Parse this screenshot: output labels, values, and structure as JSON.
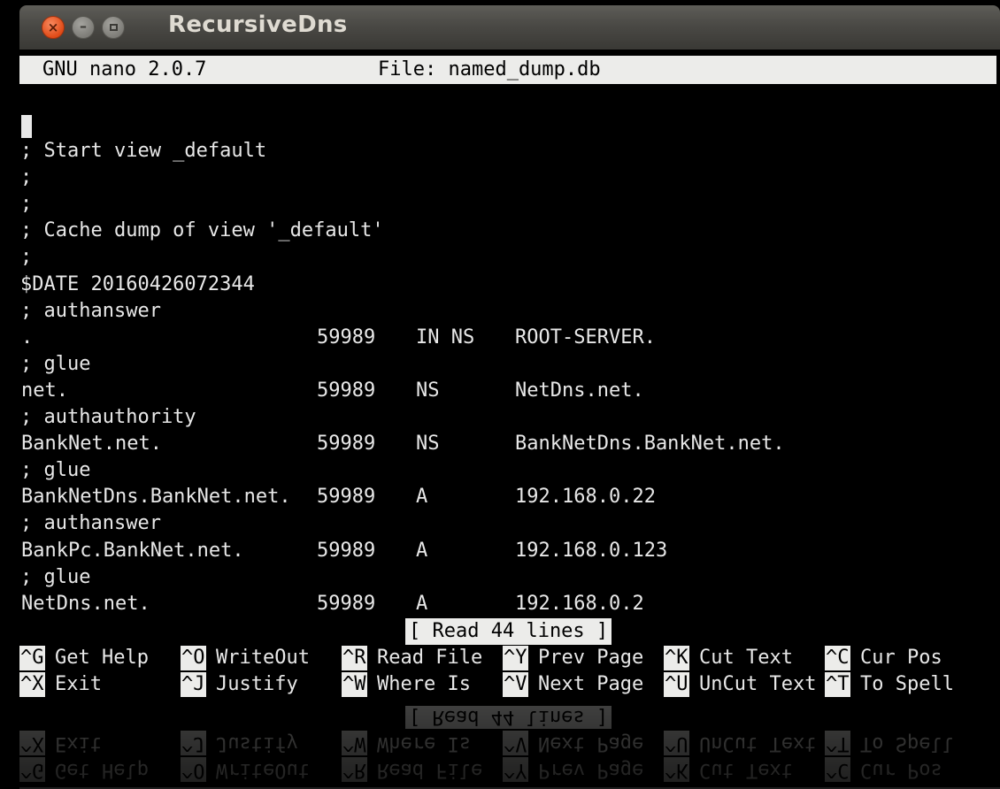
{
  "window": {
    "title": "RecursiveDns",
    "close_glyph": "×",
    "minimize_glyph": "–"
  },
  "nano": {
    "version": "GNU nano 2.0.7",
    "file": "File: named_dump.db",
    "status": "[ Read 44 lines ]"
  },
  "content": {
    "lines": [
      {
        "text": "; Start view _default"
      },
      {
        "text": ";"
      },
      {
        "text": ";"
      },
      {
        "text": "; Cache dump of view '_default'"
      },
      {
        "text": ";"
      },
      {
        "text": "$DATE 20160426072344"
      },
      {
        "text": "; authanswer"
      },
      {
        "name": ".",
        "ttl": "59989",
        "type": "IN NS",
        "data": "ROOT-SERVER."
      },
      {
        "text": "; glue"
      },
      {
        "name": "net.",
        "ttl": "59989",
        "type": "NS",
        "data": "NetDns.net."
      },
      {
        "text": "; authauthority"
      },
      {
        "name": "BankNet.net.",
        "ttl": "59989",
        "type": "NS",
        "data": "BankNetDns.BankNet.net."
      },
      {
        "text": "; glue"
      },
      {
        "name": "BankNetDns.BankNet.net.",
        "ttl": "59989",
        "type": "A",
        "data": "192.168.0.22"
      },
      {
        "text": "; authanswer"
      },
      {
        "name": "BankPc.BankNet.net.",
        "ttl": "59989",
        "type": "A",
        "data": "192.168.0.123"
      },
      {
        "text": "; glue"
      },
      {
        "name": "NetDns.net.",
        "ttl": "59989",
        "type": "A",
        "data": "192.168.0.2"
      }
    ]
  },
  "shortcuts": {
    "row1": [
      {
        "key": "^G",
        "label": "Get Help"
      },
      {
        "key": "^O",
        "label": "WriteOut"
      },
      {
        "key": "^R",
        "label": "Read File"
      },
      {
        "key": "^Y",
        "label": "Prev Page"
      },
      {
        "key": "^K",
        "label": "Cut Text"
      },
      {
        "key": "^C",
        "label": "Cur Pos"
      }
    ],
    "row2": [
      {
        "key": "^X",
        "label": "Exit"
      },
      {
        "key": "^J",
        "label": "Justify"
      },
      {
        "key": "^W",
        "label": "Where Is"
      },
      {
        "key": "^V",
        "label": "Next Page"
      },
      {
        "key": "^U",
        "label": "UnCut Text"
      },
      {
        "key": "^T",
        "label": "To Spell"
      }
    ]
  },
  "colors": {
    "title_bar": "#4a4945",
    "close_button": "#df4a17",
    "terminal_bg": "#000000",
    "terminal_fg": "#e8e8e8",
    "highlight_bg": "#ececea"
  }
}
